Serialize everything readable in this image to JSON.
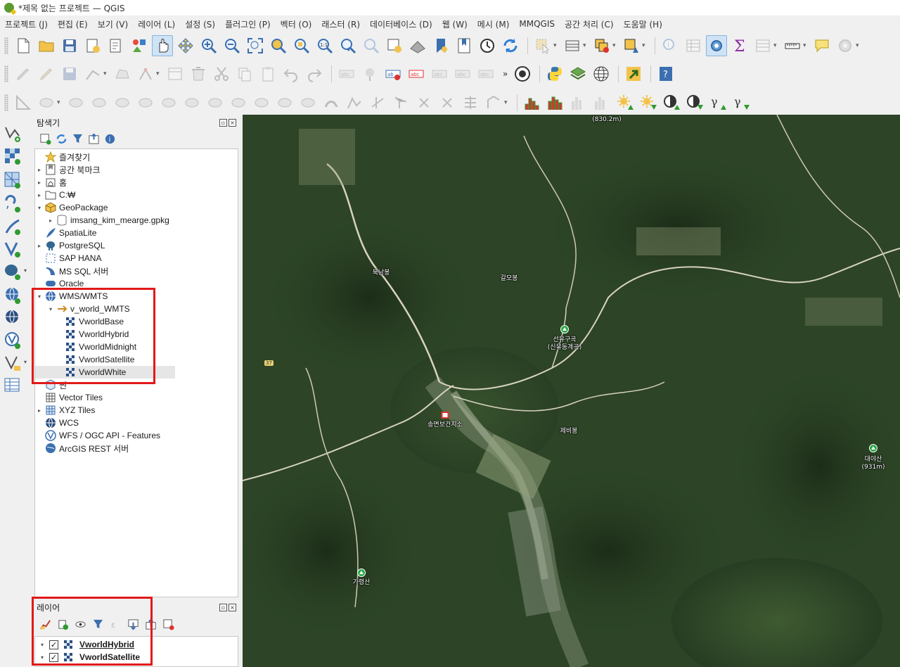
{
  "window": {
    "title": "*제목 없는 프로젝트 — QGIS"
  },
  "menubar": [
    "프로젝트 (J)",
    "편집 (E)",
    "보기 (V)",
    "레이어 (L)",
    "설정 (S)",
    "플러그인 (P)",
    "벡터 (O)",
    "래스터 (R)",
    "데이터베이스 (D)",
    "웹 (W)",
    "메시 (M)",
    "MMQGIS",
    "공간 처리 (C)",
    "도움말 (H)"
  ],
  "toolbar_more": "»",
  "browser": {
    "title": "탐색기",
    "items": [
      {
        "label": "즐겨찾기"
      },
      {
        "label": "공간 북마크"
      },
      {
        "label": "홈"
      },
      {
        "label": "C:₩"
      },
      {
        "label": "GeoPackage"
      },
      {
        "label": "imsang_kim_mearge.gpkg"
      },
      {
        "label": "SpatiaLite"
      },
      {
        "label": "PostgreSQL"
      },
      {
        "label": "SAP HANA"
      },
      {
        "label": "MS SQL 서버"
      },
      {
        "label": "Oracle"
      },
      {
        "label": "WMS/WMTS"
      },
      {
        "label": "v_world_WMTS"
      },
      {
        "label": "VworldBase"
      },
      {
        "label": "VworldHybrid"
      },
      {
        "label": "VworldMidnight"
      },
      {
        "label": "VworldSatellite"
      },
      {
        "label": "VworldWhite"
      },
      {
        "label": "씬"
      },
      {
        "label": "Vector Tiles"
      },
      {
        "label": "XYZ Tiles"
      },
      {
        "label": "WCS"
      },
      {
        "label": "WFS / OGC API - Features"
      },
      {
        "label": "ArcGIS REST 서버"
      }
    ]
  },
  "layers": {
    "title": "레이어",
    "items": [
      {
        "label": "VworldHybrid",
        "checked": true,
        "current": true
      },
      {
        "label": "VworldSatellite",
        "checked": true,
        "current": false
      }
    ]
  },
  "map": {
    "labels": {
      "top_elevation": "(830.2m)",
      "peak_north": "북남봉",
      "peak_middle": "갈모봉",
      "valley": "선유구곡",
      "valley_sub": "(신유동계곡)",
      "office": "송면보건지소",
      "peak_center": "제비봉",
      "peak_east": "대야산",
      "peak_east_elev": "(931m)",
      "peak_southwest": "가령산",
      "road_badge": "37"
    }
  },
  "colors": {
    "highlight": "#e21a1a",
    "accent": "#2f7ed8"
  }
}
